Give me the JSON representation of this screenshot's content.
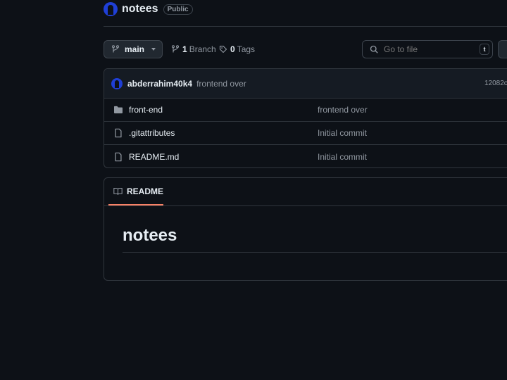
{
  "repo": {
    "name": "notees",
    "visibility": "Public"
  },
  "toolbar": {
    "branch_label": "main",
    "branches_count": "1",
    "branches_label": "Branch",
    "tags_count": "0",
    "tags_label": "Tags",
    "goto_placeholder": "Go to file",
    "goto_shortcut": "t"
  },
  "latest_commit": {
    "author": "abderrahim40k4",
    "message": "frontend over",
    "hash": "12082c"
  },
  "files": [
    {
      "type": "folder",
      "name": "front-end",
      "message": "frontend over"
    },
    {
      "type": "file",
      "name": ".gitattributes",
      "message": "Initial commit"
    },
    {
      "type": "file",
      "name": "README.md",
      "message": "Initial commit"
    }
  ],
  "readme": {
    "tab_label": "README",
    "heading": "notees"
  },
  "colors": {
    "background": "#0d1117",
    "accent_underline": "#f78166",
    "border": "#30363d",
    "muted_text": "#9198a1"
  }
}
